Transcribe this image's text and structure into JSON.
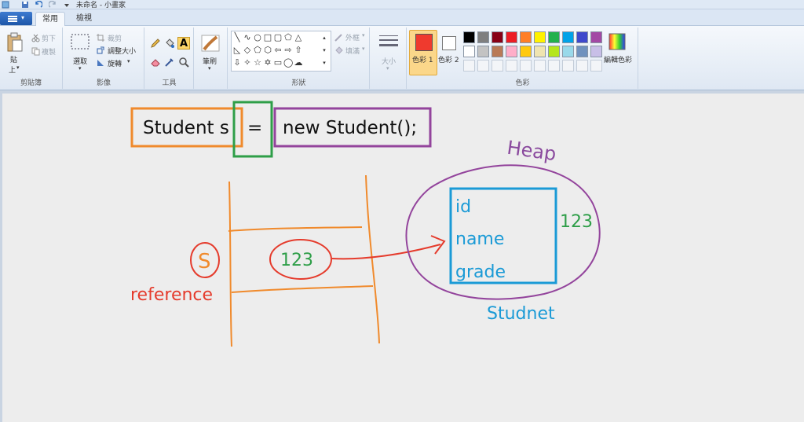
{
  "window": {
    "title": "未命名 - 小畫家"
  },
  "tabs": {
    "menu_icon": "app-menu-icon",
    "home": "常用",
    "view": "檢視"
  },
  "ribbon": {
    "clipboard": {
      "paste": "貼",
      "paste2": "上",
      "cut": "剪下",
      "copy": "複製",
      "group": "剪貼簿"
    },
    "image": {
      "select": "選取",
      "crop": "裁剪",
      "resize": "調整大小",
      "rotate": "旋轉",
      "group": "影像"
    },
    "tools": {
      "group": "工具"
    },
    "brushes": {
      "label": "筆刷"
    },
    "shapes": {
      "outline": "外框",
      "fill": "填滿",
      "group": "形狀"
    },
    "size": {
      "label": "大小"
    },
    "colors": {
      "color1": "色彩 1",
      "color2": "色彩 2",
      "edit": "編輯色彩",
      "group": "色彩",
      "color1_value": "#ef3a2e",
      "color2_value": "#ffffff",
      "palette_row1": [
        "#000000",
        "#7f7f7f",
        "#880015",
        "#ed1c24",
        "#ff7f27",
        "#fff200",
        "#22b14c",
        "#00a2e8",
        "#3f48cc",
        "#a349a4"
      ],
      "palette_row2": [
        "#ffffff",
        "#c3c3c3",
        "#b97a57",
        "#ffaec9",
        "#ffc90e",
        "#efe4b0",
        "#b5e61d",
        "#99d9ea",
        "#7092be",
        "#c8bfe7"
      ]
    }
  },
  "drawing": {
    "code": {
      "decl": "Student s",
      "eq": "=",
      "expr": "new Student();"
    },
    "heap": "Heap",
    "object_fields": [
      "id",
      "name",
      "grade"
    ],
    "object_address": "123",
    "object_label": "Studnet",
    "variable_name": "S",
    "variable_value": "123",
    "reference_label": "reference",
    "colors": {
      "orange": "#f08a2c",
      "green": "#2e9e48",
      "purple": "#93449c",
      "blue": "#1a9ad6",
      "red": "#e53b2c",
      "heap": "#8a4a9e"
    }
  }
}
